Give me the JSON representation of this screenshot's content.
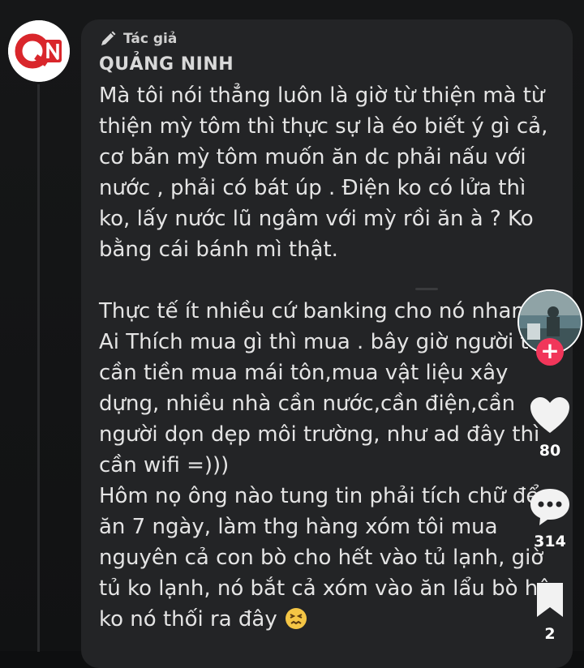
{
  "comment": {
    "author_label": "Tác giả",
    "author_name": "QUẢNG NINH",
    "text": "Mà tôi nói thẳng luôn là giờ từ thiện mà từ\nthiện mỳ tôm thì thực sự là éo biết ý gì cả,\ncơ bản mỳ tôm muốn ăn dc phải nấu với\nnước , phải có bát úp . Điện ko có lửa thì\nko, lấy nước lũ ngâm với mỳ rồi ăn à ? Ko\nbằng cái bánh mì thật.\n\nThực tế ít nhiều cứ banking cho nó nhanh\nAi Thích mua gì thì mua . bây giờ người ta\ncần tiền mua mái tôn,mua vật liệu xây\ndựng, nhiều nhà cần nước,cần điện,cần\nngười dọn dẹp môi trường, như ad đây thì\ncần wifi =)))\nHôm nọ ông nào tung tin phải tích chữ để\năn 7 ngày, làm thg hàng xóm tôi mua\nnguyên cả con bò cho hết vào tủ lạnh, giờ\ntủ ko lạnh, nó bắt cả xóm vào ăn lẩu bò hộ\nko nó thối ra đây",
    "emoji": "confounded-face"
  },
  "logo": {
    "text": "QN",
    "color": "#d9262b"
  },
  "rail": {
    "follow_label": "+",
    "likes": "80",
    "comments": "314",
    "saves": "2",
    "accent": "#f1365a"
  }
}
